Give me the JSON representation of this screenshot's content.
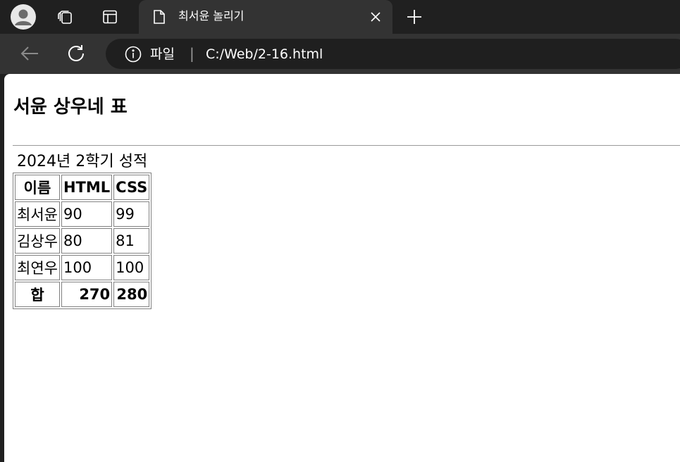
{
  "browser": {
    "tab_title": "최서윤 놀리기",
    "address_scheme_label": "파일",
    "address_separator": "|",
    "address_url": "C:/Web/2-16.html",
    "icons": {
      "profile": "profile-avatar-icon",
      "collections": "collections-icon",
      "tab_actions": "tab-actions-icon",
      "tab_favicon": "document-icon",
      "close_tab": "close-icon",
      "new_tab": "plus-icon",
      "back": "back-arrow-icon",
      "refresh": "refresh-icon",
      "info": "info-icon"
    }
  },
  "page": {
    "heading": "서윤 상우네 표",
    "table": {
      "caption": "2024년 2학기 성적",
      "headers": [
        "이름",
        "HTML",
        "CSS"
      ],
      "rows": [
        [
          "최서윤",
          "90",
          "99"
        ],
        [
          "김상우",
          "80",
          "81"
        ],
        [
          "최연우",
          "100",
          "100"
        ]
      ],
      "footer": [
        "합",
        "270",
        "280"
      ]
    }
  },
  "colors": {
    "tabbar_bg": "#202020",
    "toolbar_bg": "#333333",
    "active_tab_bg": "#333333",
    "address_bg": "#1f1f1f",
    "page_bg": "#ffffff"
  }
}
